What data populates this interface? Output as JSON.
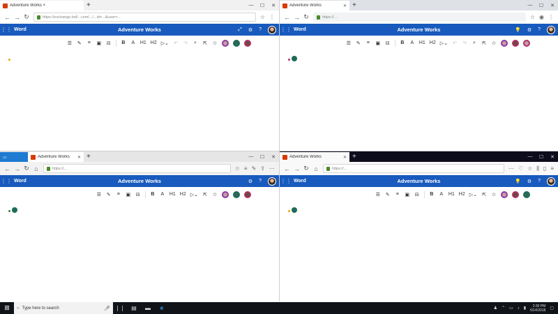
{
  "colors": {
    "word_blue": "#185abd",
    "taskbar": "#101418",
    "coauthor_1": "#8e3aa0",
    "coauthor_2": "#1e6b5a",
    "coauthor_3": "#b0306a"
  },
  "windows": [
    {
      "browser": "chrome",
      "tab_title": "Adventure Works ×",
      "url": "https://exchange.bell...com/.../...id=...&user=...",
      "app_name": "Word",
      "doc_title": "Adventure Works"
    },
    {
      "browser": "chrome-2",
      "tab_title": "Adventure Works",
      "url": "https://...",
      "app_name": "Word",
      "doc_title": "Adventure Works"
    },
    {
      "browser": "edge",
      "tab_title": "Adventure Works",
      "url": "https://...",
      "app_name": "Word",
      "doc_title": "Adventure Works"
    },
    {
      "browser": "firefox",
      "tab_title": "Adventure Works",
      "url": "https://...",
      "app_name": "Word",
      "doc_title": "Adventure Works"
    }
  ],
  "ribbon": {
    "bold": "B",
    "italic": "A",
    "h1": "H1",
    "h2": "H2",
    "more": "▷⌄"
  },
  "taskbar": {
    "search_placeholder": "Type here to search",
    "time": "2:30 PM",
    "date": "6/14/2018"
  }
}
